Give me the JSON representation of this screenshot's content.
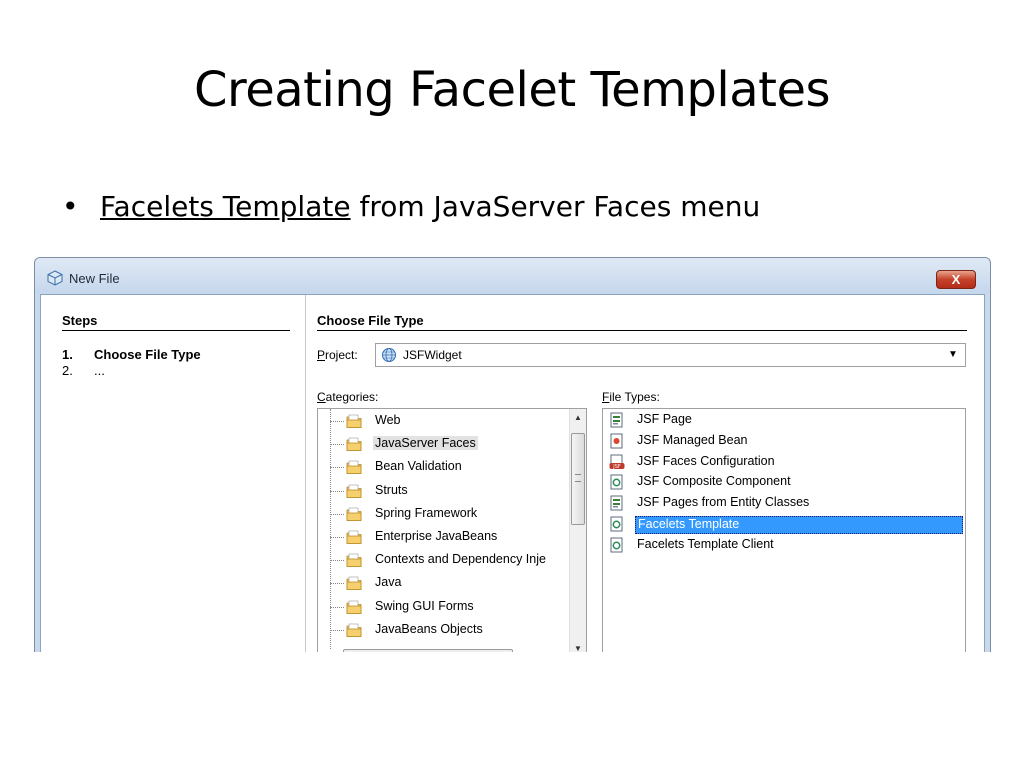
{
  "slide": {
    "title": "Creating Facelet Templates",
    "bullet_link": "Facelets Template",
    "bullet_rest": " from JavaServer Faces menu"
  },
  "window": {
    "title": "New File",
    "close_label": "X",
    "steps": {
      "heading": "Steps",
      "items": [
        {
          "num": "1.",
          "label": "Choose File Type",
          "current": true
        },
        {
          "num": "2.",
          "label": "...",
          "current": false
        }
      ]
    },
    "main": {
      "heading": "Choose File Type",
      "project_label_key": "P",
      "project_label_rest": "roject:",
      "project_value": "JSFWidget",
      "categories_label_key": "C",
      "categories_label_rest": "ategories:",
      "file_types_label_key": "F",
      "file_types_label_rest": "ile Types:",
      "categories": [
        {
          "label": "Web",
          "selected": false
        },
        {
          "label": "JavaServer Faces",
          "selected": true
        },
        {
          "label": "Bean Validation",
          "selected": false
        },
        {
          "label": "Struts",
          "selected": false
        },
        {
          "label": "Spring Framework",
          "selected": false
        },
        {
          "label": "Enterprise JavaBeans",
          "selected": false
        },
        {
          "label": "Contexts and Dependency Inje",
          "selected": false
        },
        {
          "label": "Java",
          "selected": false
        },
        {
          "label": "Swing GUI Forms",
          "selected": false
        },
        {
          "label": "JavaBeans Objects",
          "selected": false
        }
      ],
      "file_types": [
        {
          "label": "JSF Page",
          "icon": "jsf-page-icon",
          "selected": false
        },
        {
          "label": "JSF Managed Bean",
          "icon": "managed-bean-icon",
          "selected": false
        },
        {
          "label": "JSF Faces Configuration",
          "icon": "faces-config-icon",
          "selected": false
        },
        {
          "label": "JSF Composite Component",
          "icon": "composite-component-icon",
          "selected": false
        },
        {
          "label": "JSF Pages from Entity Classes",
          "icon": "entity-pages-icon",
          "selected": false
        },
        {
          "label": "Facelets Template",
          "icon": "facelets-template-icon",
          "selected": true
        },
        {
          "label": "Facelets Template Client",
          "icon": "template-client-icon",
          "selected": false
        }
      ]
    }
  },
  "colors": {
    "selection": "#3399ff",
    "window_frame": "#c9d9ec",
    "close_button": "#c6412a"
  }
}
